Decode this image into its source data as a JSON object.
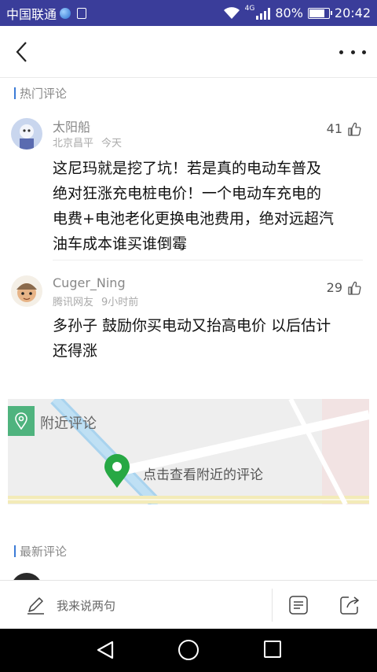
{
  "status_bar": {
    "carrier": "中国联通",
    "network": "4G",
    "battery": "80%",
    "battery_level": 0.8,
    "time": "20:42"
  },
  "hot_section": {
    "title": "热门评论"
  },
  "comments": [
    {
      "username": "太阳船",
      "location": "北京昌平",
      "time": "今天",
      "likes": "41",
      "lines": [
        "这尼玛就是挖了坑！若是真的电动车普及",
        "绝对狂涨充电桩电价！一个电动车充电的",
        "电费+电池老化更换电池费用，绝对远超汽",
        "油车成本谁买谁倒霉"
      ]
    },
    {
      "username": "Cuger_Ning",
      "location": "腾讯网友",
      "time": "9小时前",
      "likes": "29",
      "lines": [
        "多孙子 鼓励你买电动又抬高电价 以后估计",
        "还得涨"
      ]
    }
  ],
  "nearby": {
    "title": "附近评论",
    "cta": "点击查看附近的评论"
  },
  "latest_section": {
    "title": "最新评论"
  },
  "bottom_bar": {
    "compose_placeholder": "我来说两句"
  },
  "icons": {
    "back": "chevron-left-icon",
    "more": "more-dots-icon",
    "like": "thumbs-up-icon",
    "location": "location-pin-icon",
    "pencil": "pencil-icon",
    "comments_list": "comment-list-icon",
    "share": "share-icon"
  },
  "colors": {
    "status_bar": "#3a3d9a",
    "section_accent": "#3b7bd6",
    "map_tag": "#4fb37e",
    "pin": "#27a844"
  }
}
